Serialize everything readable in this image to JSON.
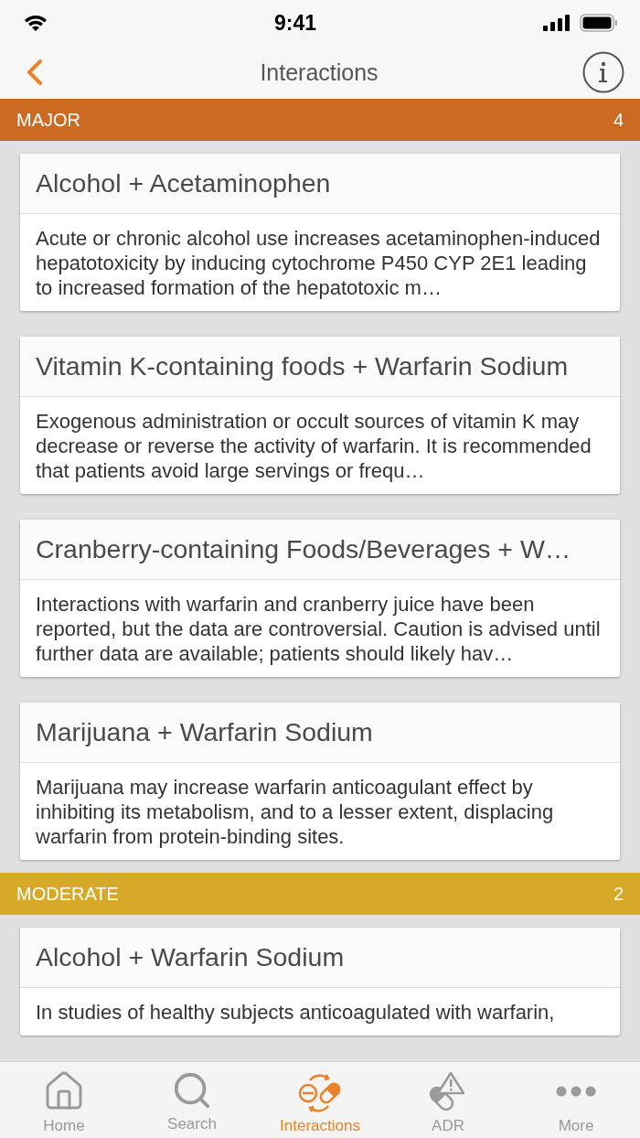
{
  "status_bar": {
    "time": "9:41"
  },
  "nav": {
    "title": "Interactions"
  },
  "sections": [
    {
      "title": "MAJOR",
      "count": "4",
      "color": "#cc6a22",
      "cards": [
        {
          "title": "Alcohol + Acetaminophen",
          "body": "Acute or chronic alcohol use increases acetaminophen-induced hepatotoxicity by inducing cytochrome P450 CYP 2E1 leading to increased formation of the hepatotoxic m…"
        },
        {
          "title": "Vitamin K-containing foods + Warfarin Sodium",
          "body": "Exogenous administration or occult sources of vitamin K may decrease or reverse the activity of warfarin. It is recommended that patients avoid large servings or frequ…"
        },
        {
          "title": "Cranberry-containing Foods/Beverages + W…",
          "body": "Interactions with warfarin and cranberry juice have been reported, but the data are controversial. Caution is advised until further data are available; patients should likely hav…"
        },
        {
          "title": "Marijuana + Warfarin Sodium",
          "body": "Marijuana may increase warfarin anticoagulant effect by inhibiting its metabolism, and to a lesser extent, displacing warfarin from protein-binding sites."
        }
      ]
    },
    {
      "title": "MODERATE",
      "count": "2",
      "color": "#d6a928",
      "cards": [
        {
          "title": "Alcohol + Warfarin Sodium",
          "body": "In studies of healthy subjects anticoagulated with warfarin,"
        }
      ]
    }
  ],
  "tabs": [
    {
      "kind": "home",
      "label": "Home",
      "selected": false
    },
    {
      "kind": "search",
      "label": "Search",
      "selected": false
    },
    {
      "kind": "interactions",
      "label": "Interactions",
      "selected": true
    },
    {
      "kind": "adr",
      "label": "ADR",
      "selected": false
    },
    {
      "kind": "more",
      "label": "More",
      "selected": false
    }
  ]
}
